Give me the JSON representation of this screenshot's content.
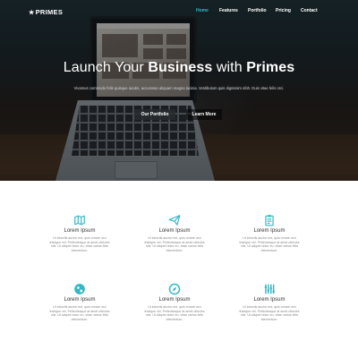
{
  "brand": {
    "name": "PRIMES"
  },
  "nav": {
    "items": [
      {
        "label": "Home",
        "active": true
      },
      {
        "label": "Features",
        "active": false
      },
      {
        "label": "Portfolio",
        "active": false
      },
      {
        "label": "Pricing",
        "active": false
      },
      {
        "label": "Contact",
        "active": false
      }
    ]
  },
  "hero": {
    "title_prefix": "Launch Your ",
    "title_bold1": "Business",
    "title_mid": " with ",
    "title_bold2": "Primes",
    "subtitle": "Vivamus commodo felis quisque iaculis, accumsan aliquam magna lacinia. Vestibulum quis dignissim nibh. Duis vitae felis orci.",
    "btn_portfolio": "Our Portfolio",
    "btn_learn": "Learn More"
  },
  "features": [
    {
      "icon": "map-icon",
      "title": "Lorem Ipsum",
      "text": "Ut lobortis auctor est, quis ornare orci tristique vel. Pellentesque at amet ultricies nisl. Ut aliquet dolor eu, vitae varius felis elementum."
    },
    {
      "icon": "paper-plane-icon",
      "title": "Lorem Ipsum",
      "text": "Ut lobortis auctor est, quis ornare orci tristique vel. Pellentesque at amet ultricies nisl. Ut aliquet dolor eu, vitae varius felis elementum."
    },
    {
      "icon": "clipboard-icon",
      "title": "Lorem Ipsum",
      "text": "Ut lobortis auctor est, quis ornare orci tristique vel. Pellentesque at amet ultricies nisl. Ut aliquet dolor eu, vitae varius felis elementum."
    },
    {
      "icon": "globe-icon",
      "title": "Lorem Ipsum",
      "text": "Ut lobortis auctor est, quis ornare orci tristique vel. Pellentesque at amet ultricies nisl. Ut aliquet dolor eu, vitae varius felis elementum."
    },
    {
      "icon": "compass-icon",
      "title": "Lorem Ipsum",
      "text": "Ut lobortis auctor est, quis ornare orci tristique vel. Pellentesque at amet ultricies nisl. Ut aliquet dolor eu, vitae varius felis elementum."
    },
    {
      "icon": "equalizer-icon",
      "title": "Lorem Ipsum",
      "text": "Ut lobortis auctor est, quis ornare orci tristique vel. Pellentesque at amet ultricies nisl. Ut aliquet dolor eu, vitae varius felis elementum."
    }
  ],
  "colors": {
    "accent": "#35b6c4",
    "hero_dark": "#1a2326",
    "text_muted": "#888888"
  }
}
